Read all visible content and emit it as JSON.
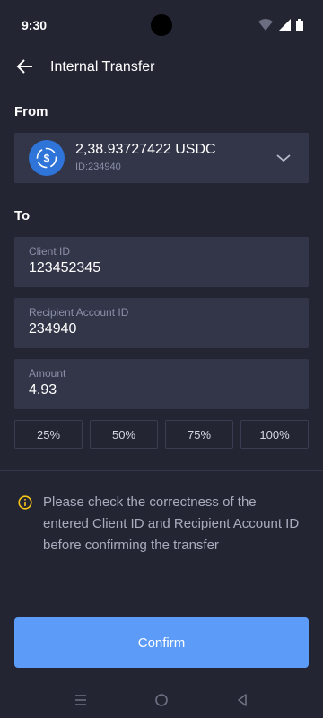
{
  "status_bar": {
    "time": "9:30"
  },
  "header": {
    "title": "Internal Transfer"
  },
  "from": {
    "label": "From",
    "balance": "2,38.93727422 USDC",
    "account_id": "ID:234940",
    "coin_icon": "usdc-coin-icon"
  },
  "to": {
    "label": "To",
    "client_id": {
      "label": "Client ID",
      "value": "123452345"
    },
    "recipient_account_id": {
      "label": "Recipient Account ID",
      "value": "234940"
    },
    "amount": {
      "label": "Amount",
      "value": "4.93"
    }
  },
  "percent_buttons": [
    "25%",
    "50%",
    "75%",
    "100%"
  ],
  "notice": {
    "text": "Please check the correctness of the entered Client ID and Recipient Account ID before confirming the transfer"
  },
  "confirm": {
    "label": "Confirm"
  },
  "colors": {
    "background": "#232533",
    "card": "#333649",
    "accent": "#5c9cf8",
    "coin": "#2e74d9",
    "warning": "#f5c518"
  }
}
